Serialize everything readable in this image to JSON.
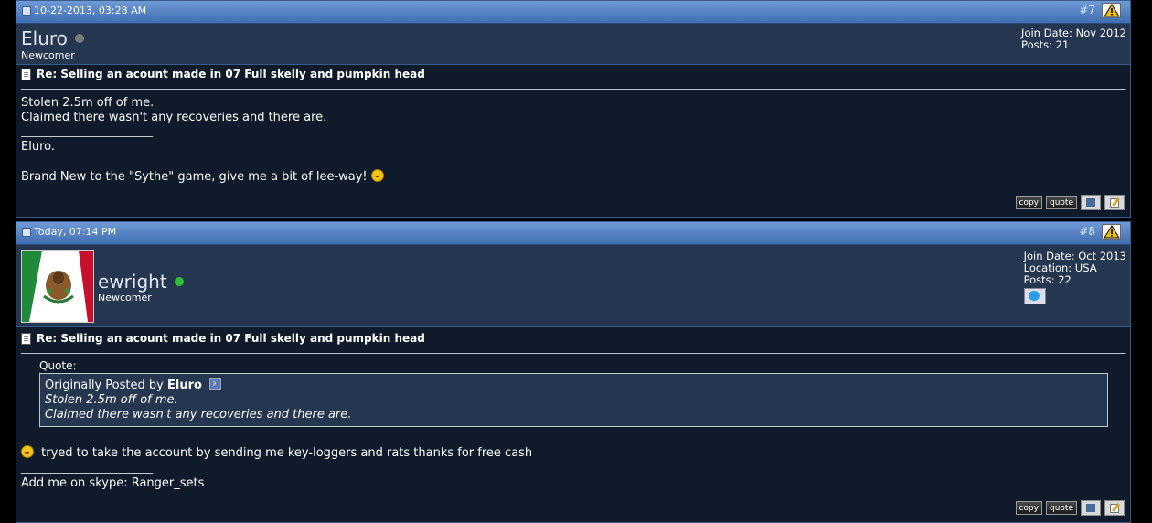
{
  "posts": [
    {
      "date": "10-22-2013, 03:28 AM",
      "number": "#7",
      "username": "Eluro",
      "status_color": "#7a7a7a",
      "user_title": "Newcomer",
      "join_date": "Join Date: Nov 2012",
      "posts_count": "Posts: 21",
      "title": "Re: Selling an acount made in 07 Full skelly and pumpkin head",
      "body_lines": [
        "Stolen 2.5m off of me.",
        "Claimed there wasn't any recoveries and there are."
      ],
      "signature_lines": [
        "Eluro.",
        "Brand New to the \"Sythe\" game, give me a bit of lee-way!"
      ],
      "actions": {
        "copy": "copy",
        "quote": "quote"
      }
    },
    {
      "date": "Today, 07:14 PM",
      "number": "#8",
      "username": "ewright",
      "status_color": "#2fc02f",
      "user_title": "Newcomer",
      "join_date": "Join Date: Oct 2013",
      "location": "Location: USA",
      "posts_count": "Posts: 22",
      "title": "Re: Selling an acount made in 07 Full skelly and pumpkin head",
      "quote": {
        "label": "Quote:",
        "originally_posted_by": "Originally Posted by",
        "author": "Eluro",
        "lines": [
          "Stolen 2.5m off of me.",
          "Claimed there wasn't any recoveries and there are."
        ]
      },
      "body_lines": [
        "tryed to take the account by sending me key-loggers and rats thanks for free cash"
      ],
      "signature_lines": [
        "Add me on skype: Ranger_sets"
      ],
      "actions": {
        "copy": "copy",
        "quote": "quote"
      }
    }
  ]
}
